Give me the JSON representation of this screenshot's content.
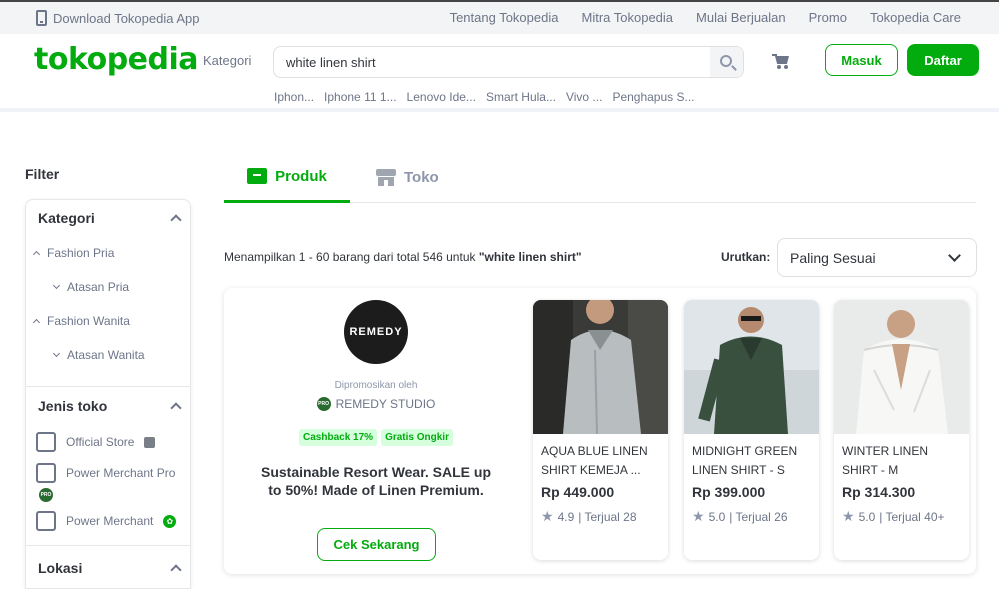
{
  "topbar": {
    "app_label": "Download Tokopedia App",
    "links": [
      "Tentang Tokopedia",
      "Mitra Tokopedia",
      "Mulai Berjualan",
      "Promo",
      "Tokopedia Care"
    ]
  },
  "header": {
    "logo": "tokopedia",
    "kategori": "Kategori",
    "search_value": "white linen shirt",
    "masuk": "Masuk",
    "daftar": "Daftar",
    "suggestions": [
      "Iphon...",
      "Iphone 11 1...",
      "Lenovo Ide...",
      "Smart Hula...",
      "Vivo ...",
      "Penghapus S..."
    ]
  },
  "filter": {
    "title": "Filter",
    "kategori_title": "Kategori",
    "categories": [
      "Fashion Pria",
      "Atasan Pria",
      "Fashion Wanita",
      "Atasan Wanita"
    ],
    "jenis_toko_title": "Jenis toko",
    "store_types": [
      "Official Store",
      "Power Merchant Pro",
      "Power Merchant"
    ],
    "pro_badge": "PRO",
    "lokasi_title": "Lokasi"
  },
  "tabs": {
    "produk": "Produk",
    "toko": "Toko"
  },
  "results": {
    "prefix": "Menampilkan 1 - 60 barang dari total 546 untuk ",
    "query": "\"white linen shirt\"",
    "sort_label": "Urutkan:",
    "sort_value": "Paling Sesuai"
  },
  "promo": {
    "brand": "REMEDY",
    "promoted_by": "Dipromosikan oleh",
    "store_name": "REMEDY STUDIO",
    "chips": [
      "Cashback 17%",
      "Gratis Ongkir"
    ],
    "description": "Sustainable Resort Wear. SALE up to 50%! Made of Linen Premium.",
    "cta": "Cek Sekarang"
  },
  "products": [
    {
      "name": "AQUA BLUE LINEN SHIRT KEMEJA ...",
      "price": "Rp 449.000",
      "rating": "4.9",
      "sold": "| Terjual 28"
    },
    {
      "name": "MIDNIGHT GREEN LINEN SHIRT - S",
      "price": "Rp 399.000",
      "rating": "5.0",
      "sold": "| Terjual 26"
    },
    {
      "name": "WINTER LINEN SHIRT - M",
      "price": "Rp 314.300",
      "rating": "5.0",
      "sold": "| Terjual 40+"
    }
  ],
  "colors": {
    "brand_green": "#03ac0e",
    "text": "#31353b",
    "muted": "#6d7588"
  }
}
